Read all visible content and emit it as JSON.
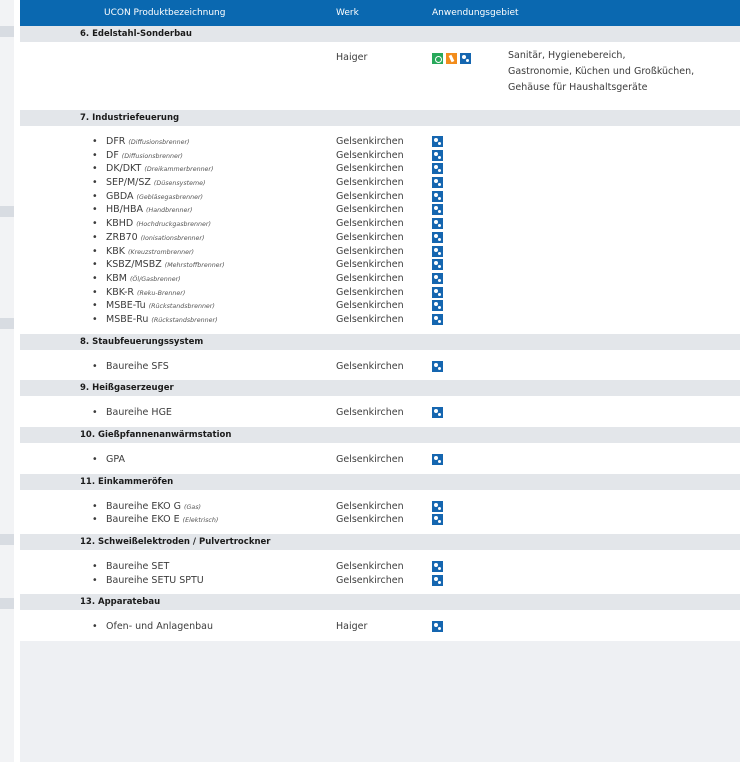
{
  "header": {
    "col_name": "UCON Produktbezeichnung",
    "col_werk": "Werk",
    "col_anwendung": "Anwendungsgebiet"
  },
  "sections": [
    {
      "title": "6.  Edelstahl-Sonderbau",
      "werk": "Haiger",
      "icons": [
        "green-leaf-icon",
        "orange-drop-icon",
        "gear-icon"
      ],
      "description": [
        "Sanitär, Hygienebereich,",
        "Gastronomie, Küchen und Großküchen,",
        "Gehäuse für Haushaltsgeräte"
      ]
    },
    {
      "title": "7. Industriefeuerung",
      "items": [
        {
          "name": "DFR",
          "sub": "(Diffusionsbrenner)",
          "werk": "Gelsenkirchen"
        },
        {
          "name": "DF",
          "sub": "(Diffusionsbrenner)",
          "werk": "Gelsenkirchen"
        },
        {
          "name": "DK/DKT",
          "sub": "(Dreikammerbrenner)",
          "werk": "Gelsenkirchen"
        },
        {
          "name": "SEP/M/SZ",
          "sub": "(Düsensysteme)",
          "werk": "Gelsenkirchen"
        },
        {
          "name": "GBDA",
          "sub": "(Gebläsegasbrenner)",
          "werk": "Gelsenkirchen"
        },
        {
          "name": "HB/HBA",
          "sub": "(Handbrenner)",
          "werk": "Gelsenkirchen"
        },
        {
          "name": "KBHD",
          "sub": "(Hochdruckgasbrenner)",
          "werk": "Gelsenkirchen"
        },
        {
          "name": "ZRB70",
          "sub": "(Ionisationsbrenner)",
          "werk": "Gelsenkirchen"
        },
        {
          "name": "KBK",
          "sub": "(Kreuzstrombrenner)",
          "werk": "Gelsenkirchen"
        },
        {
          "name": "KSBZ/MSBZ",
          "sub": "(Mehrstoffbrenner)",
          "werk": "Gelsenkirchen"
        },
        {
          "name": "KBM",
          "sub": "(Öl/Gasbrenner)",
          "werk": "Gelsenkirchen"
        },
        {
          "name": "KBK-R",
          "sub": "(Reku-Brenner)",
          "werk": "Gelsenkirchen"
        },
        {
          "name": "MSBE-Tu",
          "sub": "(Rückstandsbrenner)",
          "werk": "Gelsenkirchen"
        },
        {
          "name": "MSBE-Ru",
          "sub": "(Rückstandsbrenner)",
          "werk": "Gelsenkirchen"
        }
      ]
    },
    {
      "title": "8. Staubfeuerungssystem",
      "items": [
        {
          "name": "Baureihe SFS",
          "sub": "",
          "werk": "Gelsenkirchen"
        }
      ]
    },
    {
      "title": "9. Heißgaserzeuger",
      "items": [
        {
          "name": "Baureihe HGE",
          "sub": "",
          "werk": "Gelsenkirchen"
        }
      ]
    },
    {
      "title": "10. Gießpfannenanwärmstation",
      "items": [
        {
          "name": "GPA",
          "sub": "",
          "werk": "Gelsenkirchen"
        }
      ]
    },
    {
      "title": "11. Einkammeröfen",
      "items": [
        {
          "name": "Baureihe EKO G",
          "sub": "(Gas)",
          "werk": "Gelsenkirchen"
        },
        {
          "name": "Baureihe EKO E",
          "sub": "(Elektrisch)",
          "werk": "Gelsenkirchen"
        }
      ]
    },
    {
      "title": "12. Schweißelektroden / Pulvertrockner",
      "items": [
        {
          "name": "Baureihe SET",
          "sub": "",
          "werk": "Gelsenkirchen"
        },
        {
          "name": "Baureihe SETU SPTU",
          "sub": "",
          "werk": "Gelsenkirchen"
        }
      ]
    },
    {
      "title": "13. Apparatebau",
      "items": [
        {
          "name": "Ofen- und Anlagenbau",
          "sub": "",
          "werk": "Haiger"
        }
      ]
    }
  ],
  "bullet": "•",
  "colors": {
    "header": "#0a68b0",
    "section": "#e3e6ea",
    "gear": "#1566b0",
    "green": "#27a85a",
    "orange": "#f28c1b"
  }
}
